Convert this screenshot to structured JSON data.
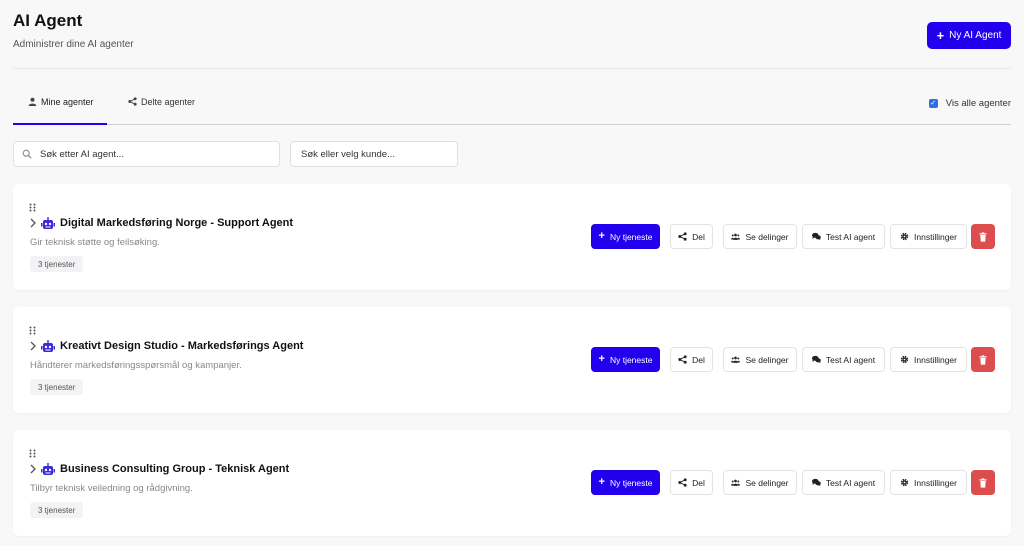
{
  "header": {
    "title": "AI Agent",
    "subtitle": "Administrer dine AI agenter",
    "new_agent_label": "Ny AI Agent"
  },
  "tabs": [
    {
      "label": "Mine agenter",
      "active": true,
      "icon": "user-icon"
    },
    {
      "label": "Delte agenter",
      "active": false,
      "icon": "share-icon"
    }
  ],
  "show_all": {
    "label": "Vis alle agenter",
    "checked": true
  },
  "search": {
    "agent_placeholder": "Søk etter AI agent...",
    "customer_placeholder": "Søk eller velg kunde..."
  },
  "actions": {
    "new_service": "Ny tjeneste",
    "share": "Del",
    "view_shares": "Se delinger",
    "test": "Test AI agent",
    "settings": "Innstillinger"
  },
  "agents": [
    {
      "name": "Digital Markedsføring Norge - Support Agent",
      "description": "Gir teknisk støtte og feilsøking.",
      "services": "3 tjenester"
    },
    {
      "name": "Kreativt Design Studio - Markedsførings Agent",
      "description": "Håndterer markedsføringsspørsmål og kampanjer.",
      "services": "3 tjenester"
    },
    {
      "name": "Business Consulting Group - Teknisk Agent",
      "description": "Tilbyr teknisk veiledning og rådgivning.",
      "services": "3 tjenester"
    }
  ],
  "colors": {
    "primary": "#2200ee",
    "danger": "#dc4e4e",
    "checkbox": "#2f6fe4"
  }
}
